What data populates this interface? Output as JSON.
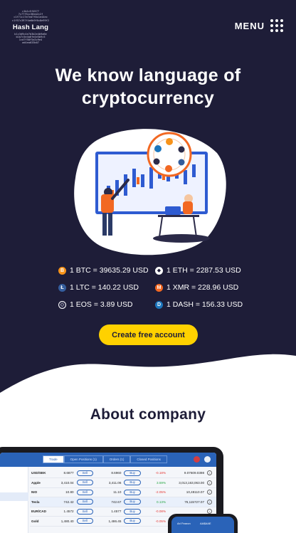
{
  "logo": {
    "code_lines": [
      "c1b1c5f4577",
      "7c77f5cc36ea2c2f",
      "c1f71c17e7ed7f0c1e44ec",
      "c1f57c397f4e6b9f6c8e99f2",
      "",
      "",
      "b1c3d9c4e7b3b2e4b9a6e",
      "b1b7c5e4a6fe4e5b9c5",
      "1cd7f58f5a3c9e4",
      "ad4ea033b07"
    ],
    "name": "Hash Lang"
  },
  "menu": {
    "label": "MENU"
  },
  "hero": {
    "title_line1": "We know language of",
    "title_line2": "cryptocurrency",
    "cta_label": "Create free account"
  },
  "rates": [
    {
      "icon": "bitcoin-icon",
      "symbol": "B",
      "color": "#f7931a",
      "text": "1 BTC = 39635.29 USD"
    },
    {
      "icon": "ethereum-icon",
      "symbol": "◆",
      "color": "#ffffff",
      "text": "1 ETH = 2287.53 USD"
    },
    {
      "icon": "litecoin-icon",
      "symbol": "Ł",
      "color": "#345d9d",
      "text": "1 LTC = 140.22 USD"
    },
    {
      "icon": "monero-icon",
      "symbol": "M",
      "color": "#f26822",
      "text": "1 XMR = 228.96 USD"
    },
    {
      "icon": "eos-icon",
      "symbol": "◇",
      "color": "#2b2a48",
      "text": "1 EOS = 3.89 USD"
    },
    {
      "icon": "dash-icon",
      "symbol": "D",
      "color": "#1c75bc",
      "text": "1 DASH = 156.33 USD"
    }
  ],
  "about": {
    "title": "About company"
  },
  "trading_app": {
    "tabs": [
      "Trade",
      "Open Positions (1)",
      "Orders (1)",
      "Closed Positions"
    ],
    "rows": [
      {
        "symbol": "USD/SEK",
        "sell": "8.6877",
        "sell_label": "Sell",
        "buy": "8.6960",
        "buy_label": "Buy",
        "change": "-0.18%",
        "volume": "9.07609.0398"
      },
      {
        "symbol": "Apple",
        "sell": "3,410.04",
        "sell_label": "Sell",
        "buy": "3,411.06",
        "buy_label": "Buy",
        "change": "3.59%",
        "volume": "3,013,163,063.00"
      },
      {
        "symbol": "NIO",
        "sell": "10.80",
        "sell_label": "Sell",
        "buy": "11.10",
        "buy_label": "Buy",
        "change": "-2.05%",
        "volume": "10,48110.07"
      },
      {
        "symbol": "Tesla",
        "sell": "742.42",
        "sell_label": "Sell",
        "buy": "742.67",
        "buy_label": "Buy",
        "change": "0.13%",
        "volume": "76,115727.07"
      },
      {
        "symbol": "EUR/CAD",
        "sell": "1.4572",
        "sell_label": "Sell",
        "buy": "1.4577",
        "buy_label": "Buy",
        "change": "-0.08%",
        "volume": ""
      },
      {
        "symbol": "Gold",
        "sell": "1,480.40",
        "sell_label": "Sell",
        "buy": "1,486.45",
        "buy_label": "Buy",
        "change": "-0.05%",
        "volume": ""
      }
    ],
    "phone_left": "Ari Fearon",
    "phone_center": "AA$AAE"
  },
  "colors": {
    "hero_bg": "#1e1d38",
    "accent_yellow": "#ffd100",
    "app_blue": "#2a63b8"
  }
}
